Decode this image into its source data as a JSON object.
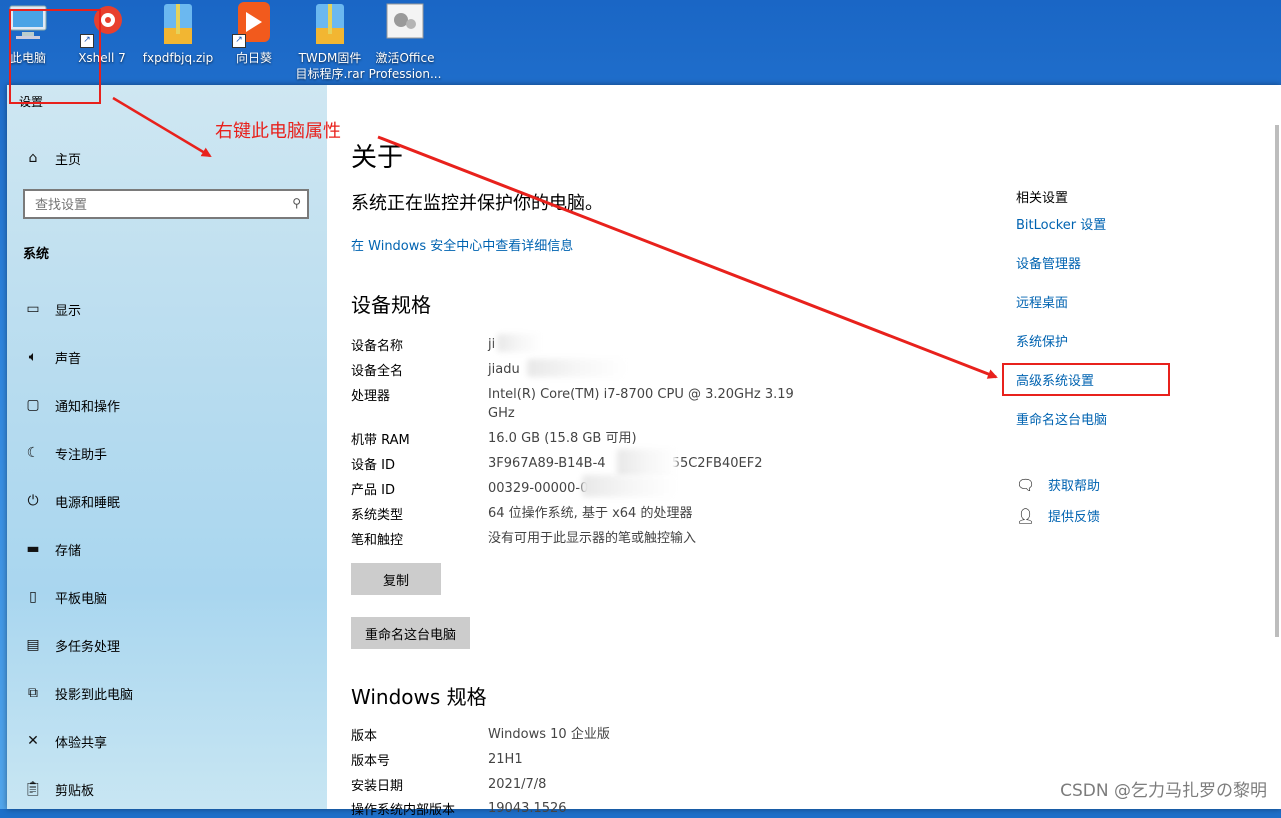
{
  "desktop": {
    "icons": [
      {
        "label": "此电脑",
        "label2": "",
        "icon": "computer-icon"
      },
      {
        "label": "Xshell 7",
        "label2": "",
        "icon": "xshell-icon"
      },
      {
        "label": "fxpdfbjq.zip",
        "label2": "",
        "icon": "zip-archive-icon"
      },
      {
        "label": "向日葵",
        "label2": "",
        "icon": "sunflower-app-icon"
      },
      {
        "label": "TWDM固件",
        "label2": "目标程序.rar",
        "icon": "rar-archive-icon"
      },
      {
        "label": "激活Office",
        "label2": "Profession...",
        "icon": "office-activator-icon"
      }
    ]
  },
  "window": {
    "title": "设置",
    "controls": {
      "minimize": "—",
      "maximize": "☐",
      "close": "✕"
    }
  },
  "sidebar": {
    "home": "主页",
    "search_placeholder": "查找设置",
    "section": "系统",
    "items": [
      {
        "label": "显示",
        "icon": "display-icon"
      },
      {
        "label": "声音",
        "icon": "sound-icon"
      },
      {
        "label": "通知和操作",
        "icon": "notification-icon"
      },
      {
        "label": "专注助手",
        "icon": "focus-moon-icon"
      },
      {
        "label": "电源和睡眠",
        "icon": "power-icon"
      },
      {
        "label": "存储",
        "icon": "storage-icon"
      },
      {
        "label": "平板电脑",
        "icon": "tablet-icon"
      },
      {
        "label": "多任务处理",
        "icon": "multitask-icon"
      },
      {
        "label": "投影到此电脑",
        "icon": "project-icon"
      },
      {
        "label": "体验共享",
        "icon": "share-icon"
      },
      {
        "label": "剪贴板",
        "icon": "clipboard-icon"
      }
    ]
  },
  "main": {
    "title": "关于",
    "protect_text": "系统正在监控并保护你的电脑。",
    "security_link": "在 Windows 安全中心中查看详细信息",
    "device_spec_title": "设备规格",
    "device_specs": [
      {
        "label": "设备名称",
        "value": "ji"
      },
      {
        "label": "设备全名",
        "value": "jiadu"
      },
      {
        "label": "处理器",
        "value": "Intel(R) Core(TM) i7-8700 CPU @ 3.20GHz   3.19 GHz"
      },
      {
        "label": "机带 RAM",
        "value": "16.0 GB (15.8 GB 可用)"
      },
      {
        "label": "设备 ID",
        "value": "3F967A89-B14B-4              755C2FB40EF2"
      },
      {
        "label": "产品 ID",
        "value": "00329-00000-0"
      },
      {
        "label": "系统类型",
        "value": "64 位操作系统, 基于 x64 的处理器"
      },
      {
        "label": "笔和触控",
        "value": "没有可用于此显示器的笔或触控输入"
      }
    ],
    "copy_button": "复制",
    "rename_button": "重命名这台电脑",
    "windows_spec_title": "Windows 规格",
    "windows_specs": [
      {
        "label": "版本",
        "value": "Windows 10 企业版"
      },
      {
        "label": "版本号",
        "value": "21H1"
      },
      {
        "label": "安装日期",
        "value": "2021/7/8"
      },
      {
        "label": "操作系统内部版本",
        "value": "19043.1526"
      }
    ]
  },
  "related": {
    "title": "相关设置",
    "links": [
      "BitLocker 设置",
      "设备管理器",
      "远程桌面",
      "系统保护",
      "高级系统设置",
      "重命名这台电脑"
    ],
    "help": [
      {
        "label": "获取帮助",
        "icon": "help-chat-icon"
      },
      {
        "label": "提供反馈",
        "icon": "feedback-icon"
      }
    ]
  },
  "annotation": {
    "text": "右键此电脑属性",
    "color": "#e8211c"
  },
  "watermark": "CSDN @乞力马扎罗の黎明"
}
